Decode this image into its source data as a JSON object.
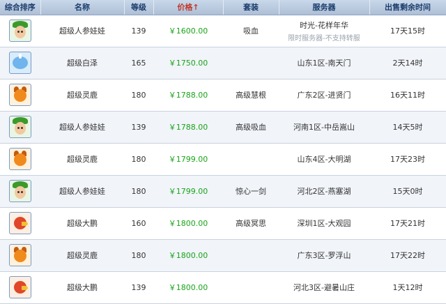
{
  "headers": {
    "rank": "综合排序",
    "name": "名称",
    "level": "等级",
    "price": "价格↑",
    "suit": "套装",
    "server": "服务器",
    "time": "出售剩余时间"
  },
  "rows": [
    {
      "icon": "ginseng-baby-icon",
      "name": "超级人参娃娃",
      "level": "139",
      "price": "￥1600.00",
      "suit": "吸血",
      "server": "时光-花样年华",
      "server_note": "限时服务器-不支持转服",
      "time": "17天15时"
    },
    {
      "icon": "baize-icon",
      "name": "超级白泽",
      "level": "165",
      "price": "￥1750.00",
      "suit": "",
      "server": "山东1区-南天门",
      "server_note": "",
      "time": "2天14时"
    },
    {
      "icon": "spirit-deer-icon",
      "name": "超级灵鹿",
      "level": "180",
      "price": "￥1788.00",
      "suit": "高级慧根",
      "server": "广东2区-进贤门",
      "server_note": "",
      "time": "16天11时"
    },
    {
      "icon": "ginseng-baby-icon",
      "name": "超级人参娃娃",
      "level": "139",
      "price": "￥1788.00",
      "suit": "高级吸血",
      "server": "河南1区-中岳嵩山",
      "server_note": "",
      "time": "14天5时"
    },
    {
      "icon": "spirit-deer-icon",
      "name": "超级灵鹿",
      "level": "180",
      "price": "￥1799.00",
      "suit": "",
      "server": "山东4区-大明湖",
      "server_note": "",
      "time": "17天23时"
    },
    {
      "icon": "ginseng-baby-icon",
      "name": "超级人参娃娃",
      "level": "180",
      "price": "￥1799.00",
      "suit": "惊心一剑",
      "server": "河北2区-燕塞湖",
      "server_note": "",
      "time": "15天0时"
    },
    {
      "icon": "great-peng-icon",
      "name": "超级大鹏",
      "level": "160",
      "price": "￥1800.00",
      "suit": "高级冥思",
      "server": "深圳1区-大观园",
      "server_note": "",
      "time": "17天21时"
    },
    {
      "icon": "spirit-deer-icon",
      "name": "超级灵鹿",
      "level": "180",
      "price": "￥1800.00",
      "suit": "",
      "server": "广东3区-罗浮山",
      "server_note": "",
      "time": "17天22时"
    },
    {
      "icon": "great-peng-icon",
      "name": "超级大鹏",
      "level": "139",
      "price": "￥1800.00",
      "suit": "",
      "server": "河北3区-避暑山庄",
      "server_note": "",
      "time": "1天12时"
    }
  ],
  "colors": {
    "price": "#19a319",
    "header_bg": "#b8c8de",
    "sort_active": "#c0392b"
  }
}
